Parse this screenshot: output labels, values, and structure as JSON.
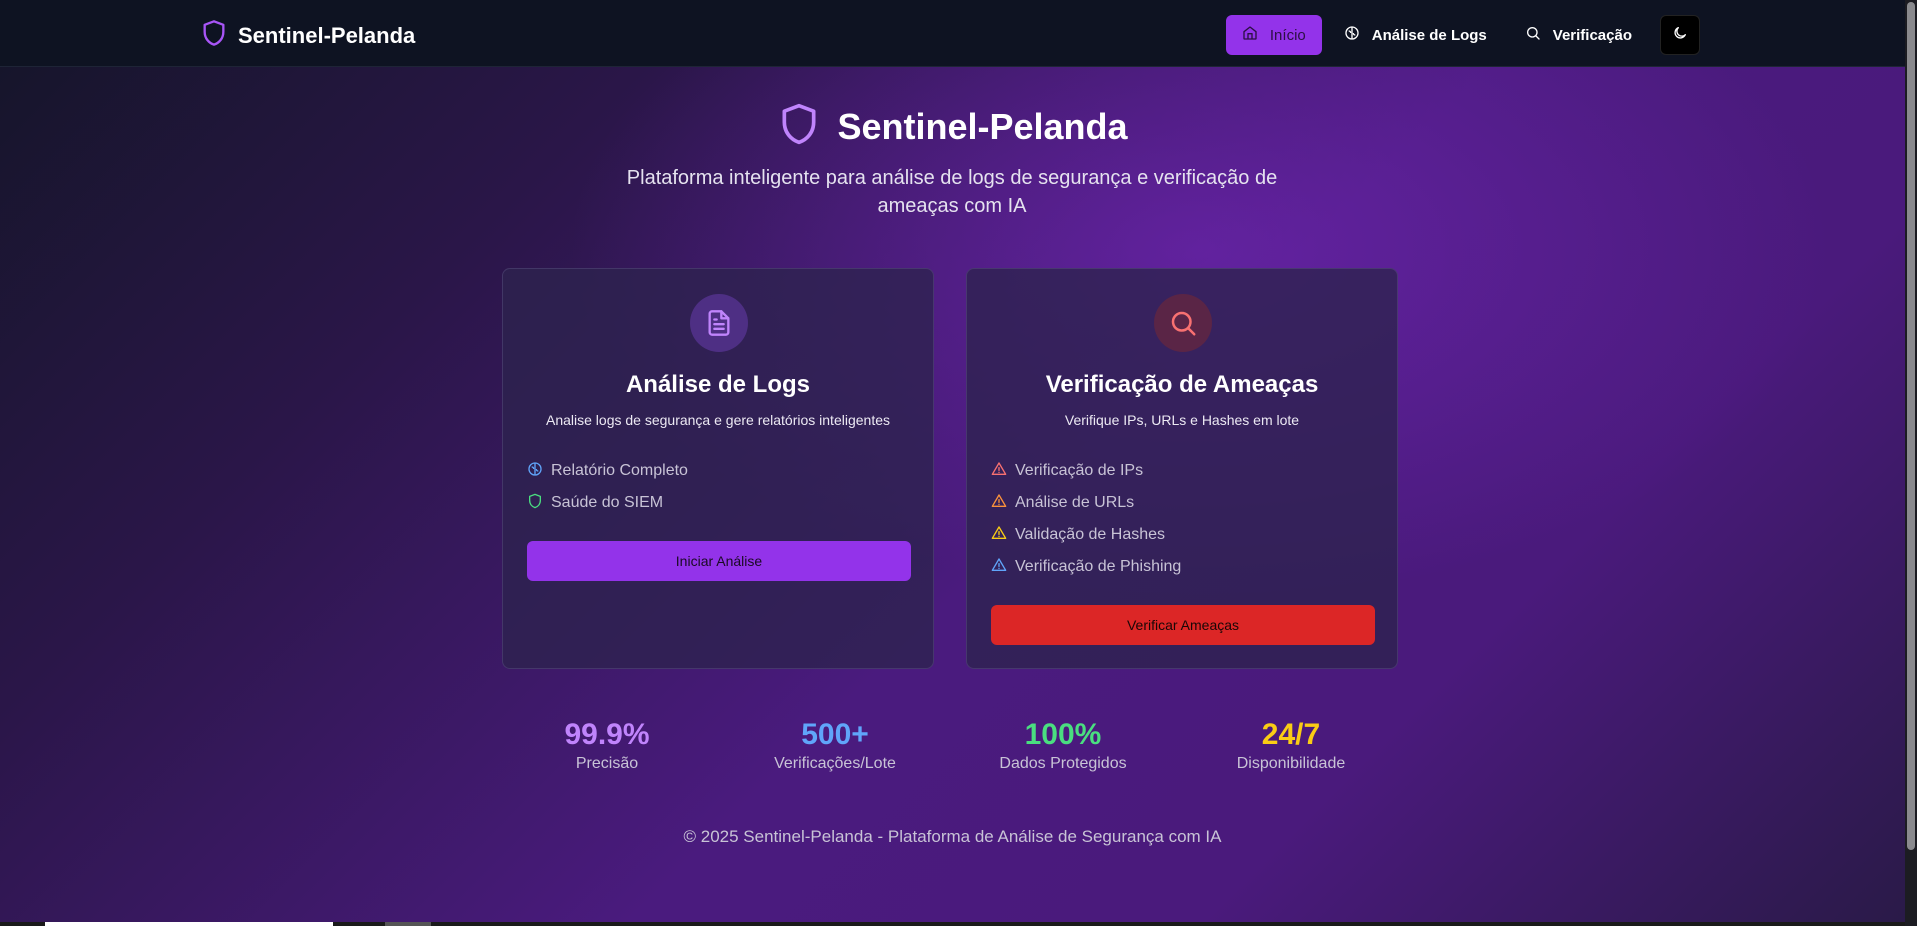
{
  "brand": {
    "name": "Sentinel-Pelanda",
    "icon": "shield-icon"
  },
  "nav": {
    "items": [
      {
        "label": "Início",
        "icon": "home-icon",
        "active": true
      },
      {
        "label": "Análise de Logs",
        "icon": "brain-icon",
        "active": false
      },
      {
        "label": "Verificação",
        "icon": "search-icon",
        "active": false
      }
    ],
    "theme_toggle_icon": "moon-icon"
  },
  "hero": {
    "title": "Sentinel-Pelanda",
    "subtitle": "Plataforma inteligente para análise de logs de segurança e verificação de ameaças com IA"
  },
  "cards": [
    {
      "icon": "document-icon",
      "title": "Análise de Logs",
      "description": "Analise logs de segurança e gere relatórios inteligentes",
      "features": [
        {
          "label": "Relatório Completo",
          "icon": "brain-icon",
          "color": "#60a5fa"
        },
        {
          "label": "Saúde do SIEM",
          "icon": "shield-icon",
          "color": "#4ade80"
        }
      ],
      "button": "Iniciar Análise"
    },
    {
      "icon": "search-icon",
      "title": "Verificação de Ameaças",
      "description": "Verifique IPs, URLs e Hashes em lote",
      "features": [
        {
          "label": "Verificação de IPs",
          "icon": "warning-icon",
          "color": "#f87171"
        },
        {
          "label": "Análise de URLs",
          "icon": "warning-icon",
          "color": "#fb923c"
        },
        {
          "label": "Validação de Hashes",
          "icon": "warning-icon",
          "color": "#facc15"
        },
        {
          "label": "Verificação de Phishing",
          "icon": "warning-icon",
          "color": "#60a5fa"
        }
      ],
      "button": "Verificar Ameaças"
    }
  ],
  "stats": [
    {
      "value": "99.9%",
      "label": "Precisão",
      "color": "#c084fc"
    },
    {
      "value": "500+",
      "label": "Verificações/Lote",
      "color": "#60a5fa"
    },
    {
      "value": "100%",
      "label": "Dados Protegidos",
      "color": "#4ade80"
    },
    {
      "value": "24/7",
      "label": "Disponibilidade",
      "color": "#facc15"
    }
  ],
  "footer": {
    "text": "© 2025 Sentinel-Pelanda - Plataforma de Análise de Segurança com IA"
  },
  "colors": {
    "accent": "#9333ea",
    "danger": "#dc2626",
    "nav_bg": "#0e1322"
  }
}
